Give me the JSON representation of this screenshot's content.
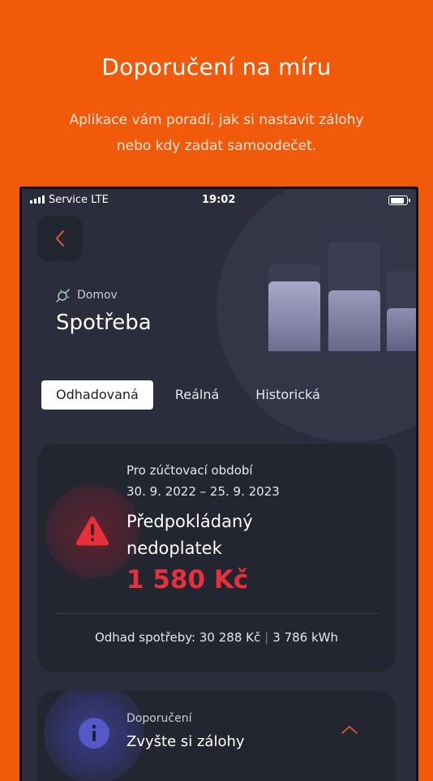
{
  "promo": {
    "title": "Doporučení na míru",
    "subtitle_line1": "Aplikace vám poradí, jak si nastavit zálohy",
    "subtitle_line2": "nebo kdy zadat samoodečet."
  },
  "status_bar": {
    "carrier": "Service  LTE",
    "time": "19:02"
  },
  "header": {
    "breadcrumb": "Domov",
    "title": "Spotřeba",
    "back_icon": "chevron-left-icon",
    "breadcrumb_icon": "plug-icon"
  },
  "tabs": [
    {
      "label": "Odhadovaná",
      "active": true
    },
    {
      "label": "Reálná",
      "active": false
    },
    {
      "label": "Historická",
      "active": false
    }
  ],
  "estimate_card": {
    "period_label": "Pro zúčtovací období",
    "period_dates": "30. 9. 2022 – 25. 9. 2023",
    "status_line1": "Předpokládaný",
    "status_line2": "nedoplatek",
    "amount": "1 580 Kč",
    "summary_cost": "Odhad spotřeby: 30 288 Kč",
    "summary_energy": "3 786 kWh",
    "icon": "warning-triangle-icon"
  },
  "recommendation_card": {
    "label": "Doporučení",
    "title": "Zvyšte si zálohy",
    "icon": "info-icon",
    "toggle_icon": "chevron-up-icon"
  },
  "colors": {
    "brand_orange": "#f15a0a",
    "app_background": "#2b2d3c",
    "card_background": "#232530",
    "accent_red": "#e8303c",
    "back_chevron": "#e8602a"
  }
}
